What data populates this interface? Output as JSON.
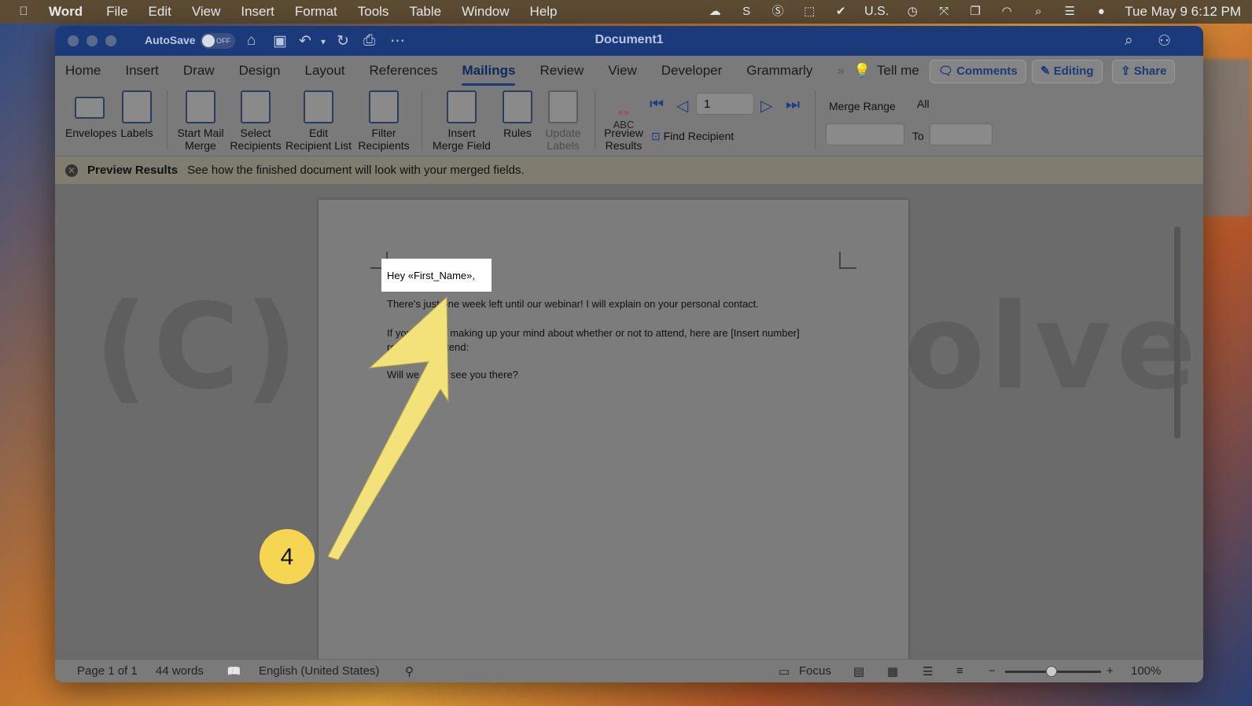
{
  "menubar": {
    "app": "Word",
    "items": [
      "File",
      "Edit",
      "View",
      "Insert",
      "Format",
      "Tools",
      "Table",
      "Window",
      "Help"
    ],
    "input_source": "U.S.",
    "clock": "Tue May 9  6:12 PM"
  },
  "titlebar": {
    "autosave_label": "AutoSave",
    "autosave_state": "OFF",
    "document_title": "Document1"
  },
  "tabs": [
    "Home",
    "Insert",
    "Draw",
    "Design",
    "Layout",
    "References",
    "Mailings",
    "Review",
    "View",
    "Developer",
    "Grammarly"
  ],
  "active_tab": "Mailings",
  "tell_me": "Tell me",
  "actions": {
    "comments": "Comments",
    "editing": "Editing",
    "share": "Share"
  },
  "ribbon": {
    "envelopes": "Envelopes",
    "labels": "Labels",
    "start_mail_merge": [
      "Start Mail",
      "Merge"
    ],
    "select_recipients": [
      "Select",
      "Recipients"
    ],
    "edit_recipient_list": [
      "Edit",
      "Recipient List"
    ],
    "filter_recipients": [
      "Filter",
      "Recipients"
    ],
    "insert_merge_field": [
      "Insert",
      "Merge Field"
    ],
    "rules": "Rules",
    "update_labels": [
      "Update",
      "Labels"
    ],
    "preview_abc": "ABC",
    "preview_results": [
      "Preview",
      "Results"
    ],
    "record_number": "1",
    "find_recipient": "Find Recipient",
    "merge_range_label": "Merge Range",
    "merge_range_value": "All",
    "to_label": "To"
  },
  "message_bar": {
    "title": "Preview Results",
    "text": "See how the finished document will look with your merged fields."
  },
  "document": {
    "greeting": "Hey «First_Name»,",
    "line1": "There's just one week left until our webinar! I will explain on your personal contact.",
    "line2a": "If you are still making up your mind about whether or not to attend, here are [Insert number]",
    "line2b": "reasons to attend:",
    "line3": "Will we get to see you there?",
    "watermark": "(C) howtoisolve.com"
  },
  "status": {
    "page": "Page 1 of 1",
    "words": "44 words",
    "language": "English (United States)",
    "focus": "Focus",
    "zoom": "100%"
  },
  "annotation": {
    "step": "4",
    "color": "#f3e27a"
  },
  "colors": {
    "titlebar": "#1b3a7a",
    "accent": "#1c3c86"
  }
}
